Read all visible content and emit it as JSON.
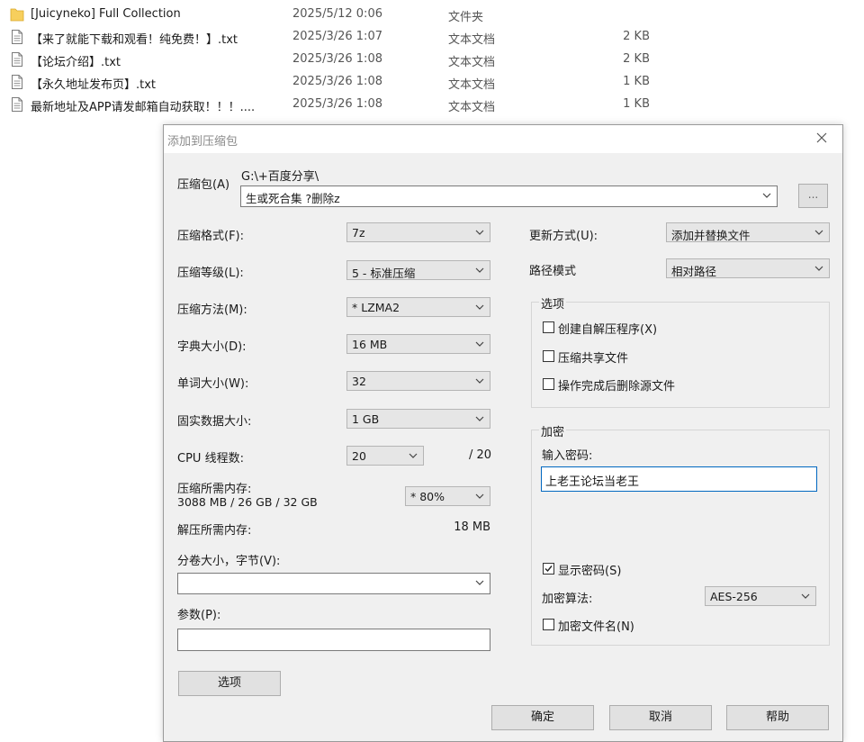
{
  "explorer": {
    "files": [
      {
        "name": "[Juicyneko] Full Collection",
        "date": "2025/5/12 0:06",
        "type": "文件夹",
        "size": "",
        "icon": "folder-icon"
      },
      {
        "name": "【来了就能下载和观看！纯免费！】.txt",
        "date": "2025/3/26 1:07",
        "type": "文本文档",
        "size": "2 KB",
        "icon": "text-file-icon"
      },
      {
        "name": "【论坛介绍】.txt",
        "date": "2025/3/26 1:08",
        "type": "文本文档",
        "size": "2 KB",
        "icon": "text-file-icon"
      },
      {
        "name": "【永久地址发布页】.txt",
        "date": "2025/3/26 1:08",
        "type": "文本文档",
        "size": "1 KB",
        "icon": "text-file-icon"
      },
      {
        "name": "最新地址及APP请发邮箱自动获取！！！....",
        "date": "2025/3/26 1:08",
        "type": "文本文档",
        "size": "1 KB",
        "icon": "text-file-icon"
      }
    ]
  },
  "dialog": {
    "title": "添加到压缩包",
    "archive": {
      "label": "压缩包(A)",
      "path": "G:\\+百度分享\\",
      "name": "生或死合集 ?删除z",
      "browse_label": "..."
    },
    "left": {
      "format": {
        "label": "压缩格式(F):",
        "value": "7z"
      },
      "level": {
        "label": "压缩等级(L):",
        "value": "5 - 标准压缩"
      },
      "method": {
        "label": "压缩方法(M):",
        "value": "* LZMA2"
      },
      "dict": {
        "label": "字典大小(D):",
        "value": "16 MB"
      },
      "word": {
        "label": "单词大小(W):",
        "value": "32"
      },
      "solid": {
        "label": "固实数据大小:",
        "value": "1 GB"
      },
      "threads": {
        "label": "CPU 线程数:",
        "value": "20",
        "max": "/ 20"
      },
      "memory_compress": {
        "label": "压缩所需内存:",
        "detail": "3088 MB / 26 GB / 32 GB",
        "value": "* 80%"
      },
      "memory_decompress": {
        "label": "解压所需内存:",
        "value": "18 MB"
      },
      "volume": {
        "label": "分卷大小，字节(V):",
        "value": ""
      },
      "params": {
        "label": "参数(P):",
        "value": ""
      },
      "options_button": "选项"
    },
    "right": {
      "update": {
        "label": "更新方式(U):",
        "value": "添加并替换文件"
      },
      "path_mode": {
        "label": "路径模式",
        "value": "相对路径"
      },
      "options_group": {
        "title": "选项",
        "sfx": {
          "label": "创建自解压程序(X)",
          "checked": false
        },
        "shared": {
          "label": "压缩共享文件",
          "checked": false
        },
        "delete": {
          "label": "操作完成后删除源文件",
          "checked": false
        }
      },
      "encryption": {
        "title": "加密",
        "password_label": "输入密码:",
        "password": "上老王论坛当老王",
        "show_password": {
          "label": "显示密码(S)",
          "checked": true
        },
        "method_label": "加密算法:",
        "method": "AES-256",
        "encrypt_names": {
          "label": "加密文件名(N)",
          "checked": false
        }
      }
    },
    "buttons": {
      "ok": "确定",
      "cancel": "取消",
      "help": "帮助"
    }
  },
  "colors": {
    "dialog_bg": "#f0f0f0",
    "focus_border": "#0067c0",
    "folder": "#f7cf5d"
  }
}
